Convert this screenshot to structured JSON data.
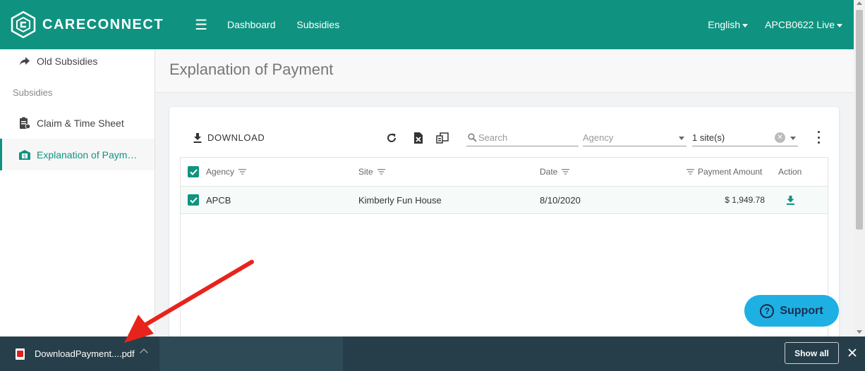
{
  "header": {
    "brand": "CARECONNECT",
    "nav": [
      "Dashboard",
      "Subsidies"
    ],
    "language": "English",
    "account": "APCB0622 Live"
  },
  "sidebar": {
    "items": [
      {
        "label": "Old Subsidies",
        "icon": "share-arrow-icon"
      },
      {
        "label": "Claim & Time Sheet",
        "icon": "clipboard-icon"
      },
      {
        "label": "Explanation of Paym…",
        "icon": "building-dollar-icon"
      }
    ],
    "section_label": "Subsidies"
  },
  "page": {
    "title": "Explanation of Payment"
  },
  "toolbar": {
    "download_label": "DOWNLOAD",
    "search_placeholder": "Search",
    "agency_placeholder": "Agency",
    "site_value": "1 site(s)"
  },
  "table": {
    "columns": {
      "agency": "Agency",
      "site": "Site",
      "date": "Date",
      "payment_amount": "Payment Amount",
      "action": "Action"
    },
    "rows": [
      {
        "agency": "APCB",
        "site": "Kimberly Fun House",
        "date": "8/10/2020",
        "payment_amount": "$ 1,949.78"
      }
    ]
  },
  "support": {
    "label": "Support"
  },
  "download_bar": {
    "file_name": "DownloadPayment....pdf",
    "show_all": "Show all"
  },
  "colors": {
    "brand_teal": "#0f9380",
    "support_blue": "#1fb0e3",
    "download_bar": "#2e4a56",
    "annotation_red": "#e8231c"
  }
}
